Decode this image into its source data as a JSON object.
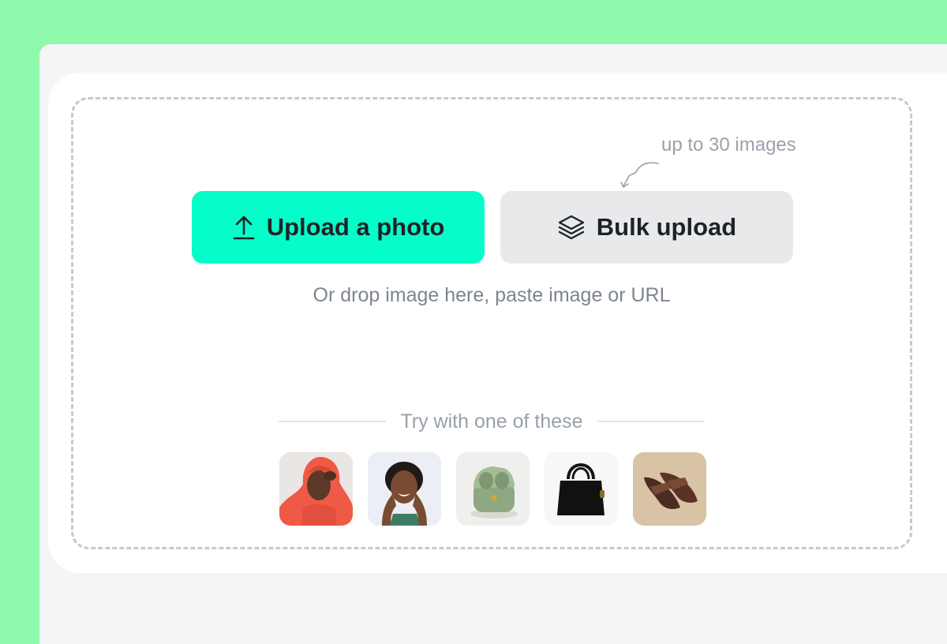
{
  "upload": {
    "primary_label": "Upload a photo",
    "bulk_label": "Bulk upload",
    "bulk_hint": "up to 30 images",
    "drop_text": "Or drop image here, paste image or URL"
  },
  "samples": {
    "heading": "Try with one of these",
    "items": [
      {
        "icon": "woman-red-hoodie-photo"
      },
      {
        "icon": "laughing-woman-photo"
      },
      {
        "icon": "green-earbuds-case-photo"
      },
      {
        "icon": "black-handbag-photo"
      },
      {
        "icon": "brown-sandals-photo"
      }
    ]
  },
  "colors": {
    "page_background": "#8ef8ab",
    "primary_button": "#05fdc9",
    "secondary_button": "#e8e9eb"
  }
}
